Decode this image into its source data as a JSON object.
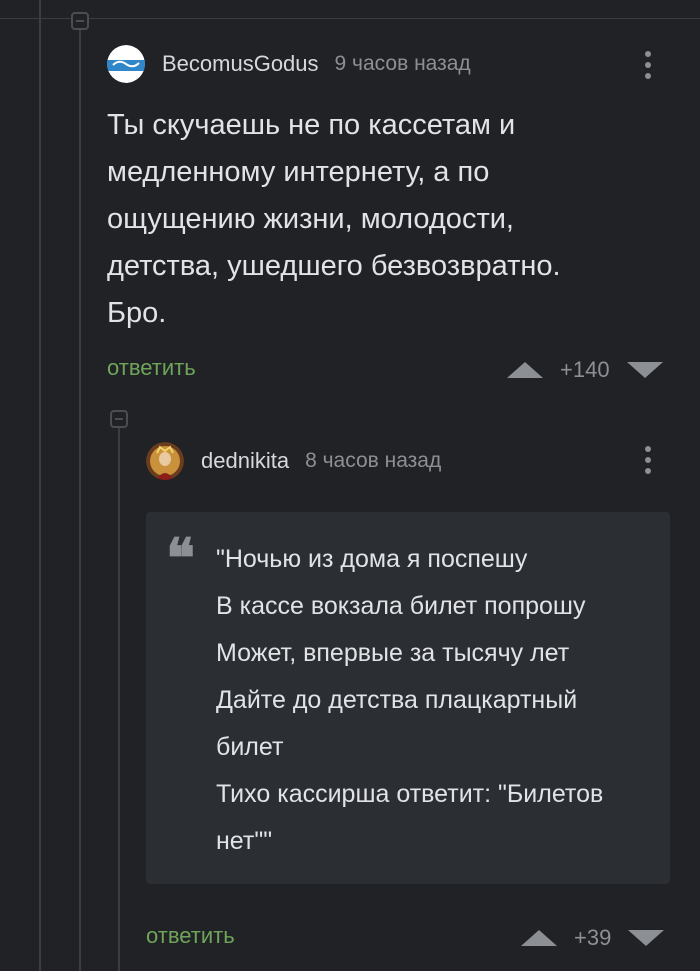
{
  "comment1": {
    "author": "BecomusGodus",
    "time": "9 часов назад",
    "body": [
      "Ты скучаешь не по кассетам и",
      "медленному интернету, а по",
      "ощущению жизни, молодости,",
      "детства, ушедшего безвозвратно.",
      "Бро."
    ],
    "reply": "ответить",
    "score": "+140"
  },
  "comment2": {
    "author": "dednikita",
    "time": "8 часов назад",
    "quote_mark": "❝",
    "quote": [
      "\"Ночью из дома я поспешу",
      "В кассе вокзала билет попрошу",
      "Может, впервые за тысячу лет",
      "Дайте до детства плацкартный",
      "билет",
      "Тихо кассирша ответит: \"Билетов",
      "нет\"\""
    ],
    "reply": "ответить",
    "score": "+39"
  }
}
